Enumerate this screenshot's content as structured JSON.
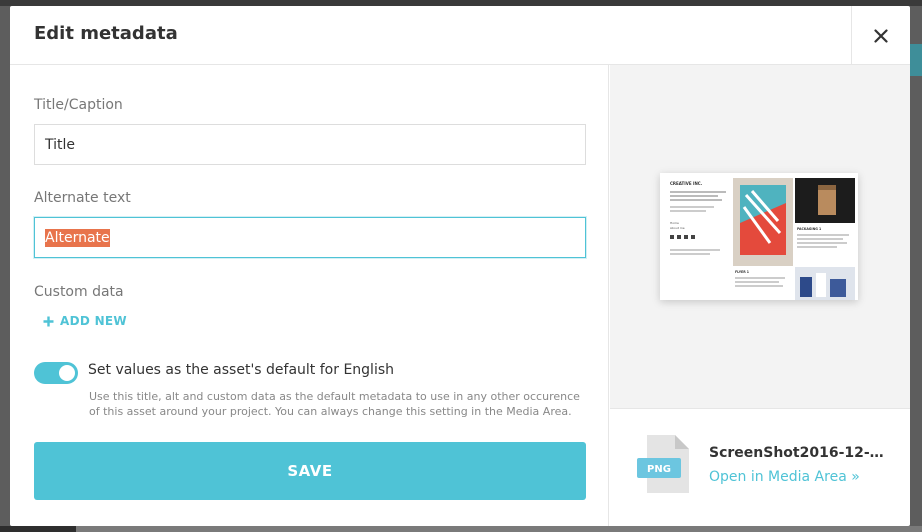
{
  "modal": {
    "title": "Edit metadata",
    "close_icon": "close-icon"
  },
  "fields": {
    "title_label": "Title/Caption",
    "title_value": "Title",
    "alt_label": "Alternate text",
    "alt_value": "Alternate",
    "custom_label": "Custom data",
    "add_new_label": "ADD NEW"
  },
  "default_toggle": {
    "label": "Set values as the asset's default for English",
    "on": true,
    "help": "Use this title, alt and custom data as the default metadata to use in any other occurence of this asset around your project. You can always change this setting in the Media Area."
  },
  "actions": {
    "save_label": "SAVE"
  },
  "asset": {
    "file_type": "PNG",
    "file_name": "ScreenShot2016-12-20...",
    "open_link": "Open in Media Area »",
    "preview": {
      "brand": "CREATIVE INC.",
      "nav_home": "Home",
      "nav_about": "About me",
      "poster_caption": "FLYER 1",
      "packaging_caption": "PACKAGING 1"
    }
  },
  "colors": {
    "accent": "#4fc3d6",
    "selection": "#e8744c",
    "text": "#333333",
    "muted": "#777777"
  }
}
